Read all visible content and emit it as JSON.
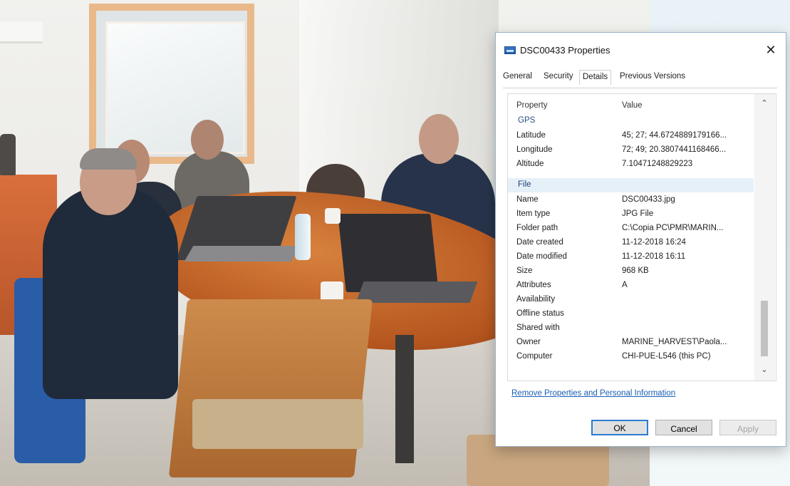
{
  "dialog": {
    "title": "DSC00433 Properties",
    "close_glyph": "✕",
    "tabs": [
      {
        "label": "General"
      },
      {
        "label": "Security"
      },
      {
        "label": "Details"
      },
      {
        "label": "Previous Versions"
      }
    ],
    "active_tab": "Details",
    "columns": {
      "property": "Property",
      "value": "Value"
    },
    "gps_group": "GPS",
    "gps_rows": [
      {
        "key": "Latitude",
        "value": "45; 27; 44.6724889179166..."
      },
      {
        "key": "Longitude",
        "value": "72; 49; 20.3807441168466..."
      },
      {
        "key": "Altitude",
        "value": "7.10471248829223"
      }
    ],
    "file_group": "File",
    "file_rows": [
      {
        "key": "Name",
        "value": "DSC00433.jpg"
      },
      {
        "key": "Item type",
        "value": "JPG File"
      },
      {
        "key": "Folder path",
        "value": "C:\\Copia PC\\PMR\\MARIN..."
      },
      {
        "key": "Date created",
        "value": "11-12-2018 16:24"
      },
      {
        "key": "Date modified",
        "value": "11-12-2018 16:11"
      },
      {
        "key": "Size",
        "value": "968 KB"
      },
      {
        "key": "Attributes",
        "value": "A"
      },
      {
        "key": "Availability",
        "value": ""
      },
      {
        "key": "Offline status",
        "value": ""
      },
      {
        "key": "Shared with",
        "value": ""
      },
      {
        "key": "Owner",
        "value": "MARINE_HARVEST\\Paola..."
      },
      {
        "key": "Computer",
        "value": "CHI-PUE-L546 (this PC)"
      }
    ],
    "scroll_up_glyph": "⌃",
    "scroll_down_glyph": "⌄",
    "remove_link": "Remove Properties and Personal Information",
    "buttons": {
      "ok": "OK",
      "cancel": "Cancel",
      "apply": "Apply"
    }
  },
  "icons": {
    "title": "file-icon",
    "close": "close-icon",
    "scroll_up": "chevron-up-icon",
    "scroll_down": "chevron-down-icon"
  },
  "colors": {
    "link": "#1a5fb4",
    "focus": "#2b7cd3",
    "group_highlight": "#e6f0f8"
  }
}
